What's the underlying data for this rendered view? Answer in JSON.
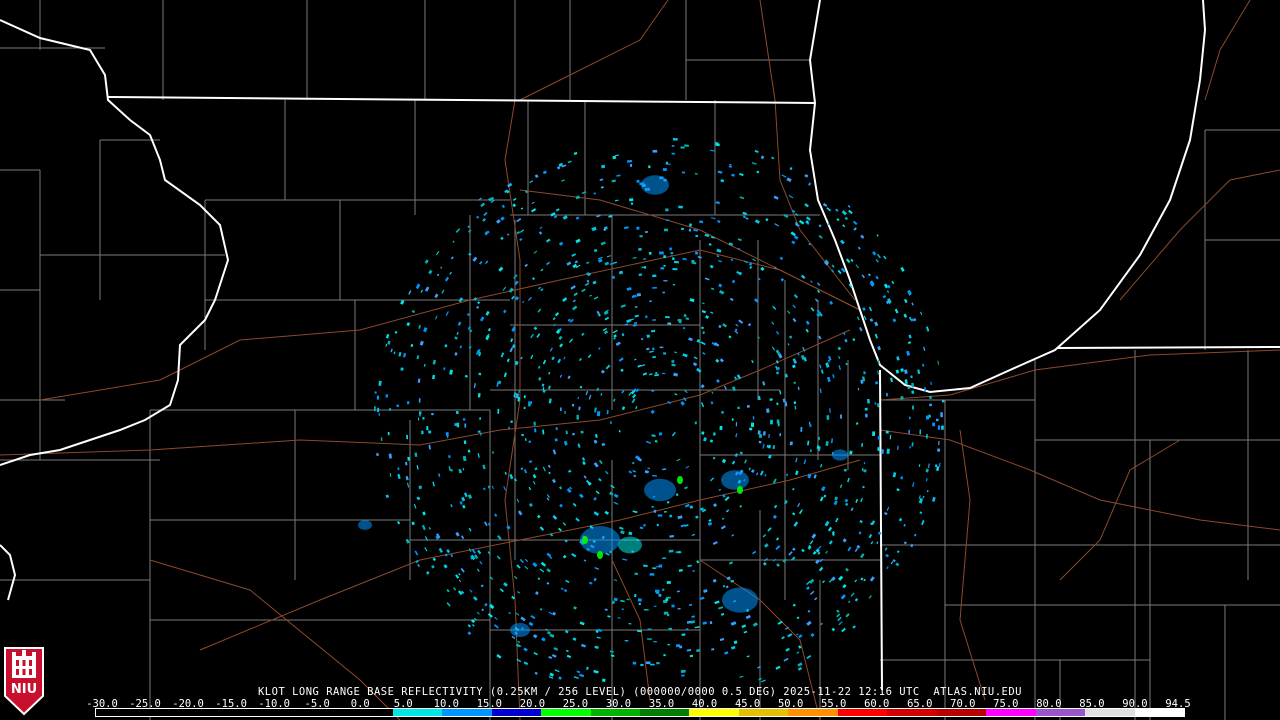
{
  "product_title": "KLOT LONG RANGE BASE REFLECTIVITY (0.25KM / 256 LEVEL) (000000/0000 0.5 DEG) 2025-11-22 12:16 UTC  ATLAS.NIU.EDU",
  "logo_text": "NIU",
  "colorbar": {
    "labels": [
      "-30.0",
      "-25.0",
      "-20.0",
      "-15.0",
      "-10.0",
      "-5.0",
      "0.0",
      "5.0",
      "10.0",
      "15.0",
      "20.0",
      "25.0",
      "30.0",
      "35.0",
      "40.0",
      "45.0",
      "50.0",
      "55.0",
      "60.0",
      "65.0",
      "70.0",
      "75.0",
      "80.0",
      "85.0",
      "90.0",
      "94.5"
    ],
    "colors": [
      "#000000",
      "#000000",
      "#000000",
      "#000000",
      "#000000",
      "#000000",
      "#00e6e6",
      "#0096ff",
      "#0000d0",
      "#00ff00",
      "#00b400",
      "#008000",
      "#ffff00",
      "#e6c000",
      "#ff9000",
      "#ff0000",
      "#d40000",
      "#b80000",
      "#ff00ff",
      "#9955c9",
      "#e0e0e0",
      "#ffffff"
    ]
  },
  "colors": {
    "state_border": "#ffffff",
    "county_border": "#808080",
    "highway": "#8b4a2b",
    "background": "#000000",
    "logo_red": "#c8102e"
  }
}
